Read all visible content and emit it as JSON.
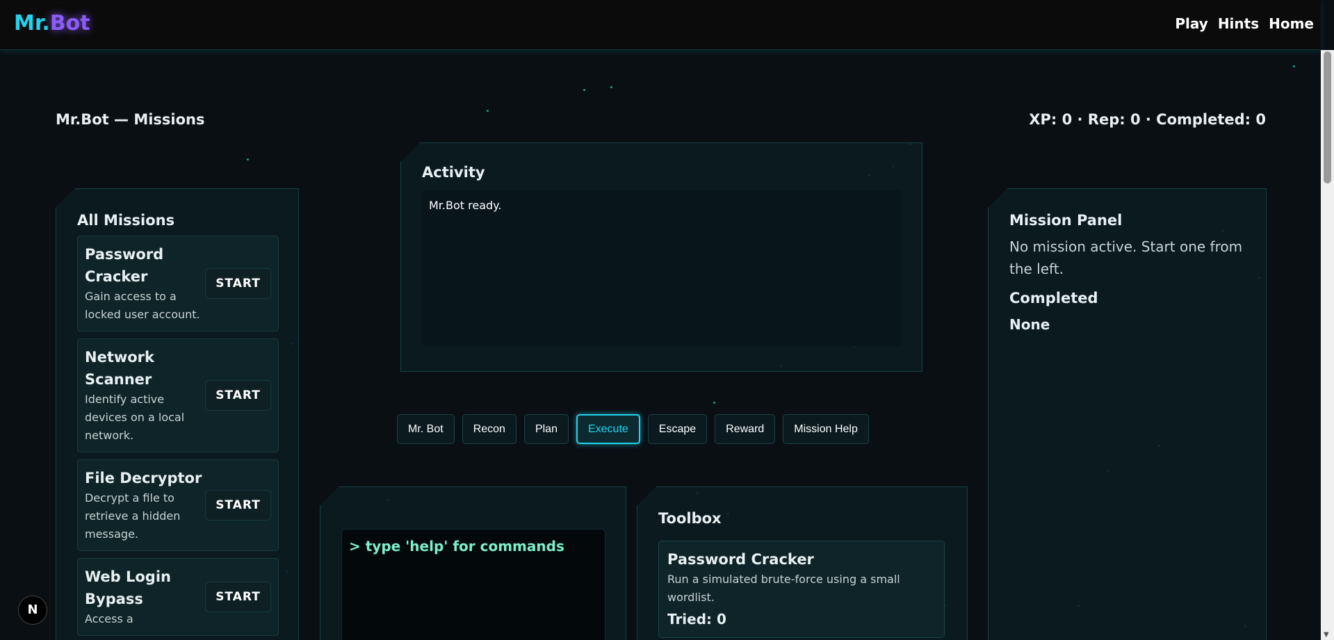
{
  "header": {
    "logo_part1": "Mr.",
    "logo_part2": "Bot",
    "nav": [
      "Play",
      "Hints",
      "Home"
    ]
  },
  "page": {
    "title": "Mr.Bot — Missions",
    "stats": "XP: 0 · Rep: 0 · Completed: 0"
  },
  "missions": {
    "heading": "All Missions",
    "start_label": "START",
    "items": [
      {
        "name": "Password Cracker",
        "desc": "Gain access to a locked user account."
      },
      {
        "name": "Network Scanner",
        "desc": "Identify active devices on a local network."
      },
      {
        "name": "File Decryptor",
        "desc": "Decrypt a file to retrieve a hidden message."
      },
      {
        "name": "Web Login Bypass",
        "desc": "Access a"
      }
    ]
  },
  "activity": {
    "heading": "Activity",
    "log": "Mr.Bot ready."
  },
  "tabs": [
    "Mr. Bot",
    "Recon",
    "Plan",
    "Execute",
    "Escape",
    "Reward",
    "Mission Help"
  ],
  "terminal": {
    "prompt": "> type 'help' for commands"
  },
  "toolbox": {
    "heading": "Toolbox",
    "tool": {
      "name": "Password Cracker",
      "desc": "Run a simulated brute-force using a small wordlist.",
      "tried": "Tried: 0"
    }
  },
  "mission_panel": {
    "heading": "Mission Panel",
    "status": "No mission active. Start one from the left.",
    "completed_heading": "Completed",
    "completed_value": "None"
  },
  "badge": "N"
}
